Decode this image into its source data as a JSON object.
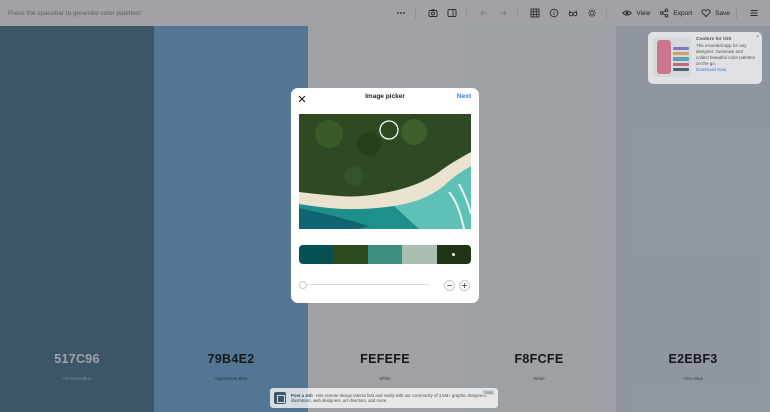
{
  "toolbar": {
    "hint": "Press the spacebar to generate color palettes!",
    "view_label": "View",
    "export_label": "Export",
    "save_label": "Save"
  },
  "palette": [
    {
      "hex": "517C96",
      "name": "Air Force Blue",
      "color": "#517c96",
      "text_color": "#ffffff"
    },
    {
      "hex": "79B4E2",
      "name": "Argentinian Blue",
      "color": "#79b4e2",
      "text_color": "#111111"
    },
    {
      "hex": "FEFEFE",
      "name": "White",
      "color": "#fefefe",
      "text_color": "#111111"
    },
    {
      "hex": "F8FCFE",
      "name": "White",
      "color": "#f8fcfe",
      "text_color": "#111111"
    },
    {
      "hex": "E2EBF3",
      "name": "Alice Blue",
      "color": "#e2ebf3",
      "text_color": "#111111"
    }
  ],
  "modal": {
    "title": "Image picker",
    "next_label": "Next",
    "slider_value": 0,
    "minus_label": "−",
    "plus_label": "+",
    "swatches": [
      "#064f52",
      "#2e4a1f",
      "#3b8f80",
      "#a9bfb2",
      "#1f3315"
    ],
    "selected_swatch": 4
  },
  "ad": {
    "title": "Coolors for iOS",
    "body": "The essential app for any designer. Generate and collect beautiful color palettes on the go.",
    "link": "Download Now",
    "close": "×"
  },
  "job": {
    "title": "Post a Job",
    "body": "Hire remote design talents fast and easily with our community of 3.5M+ graphic designers, illustrators, web designers, art directors, and more.",
    "close": "hide"
  }
}
